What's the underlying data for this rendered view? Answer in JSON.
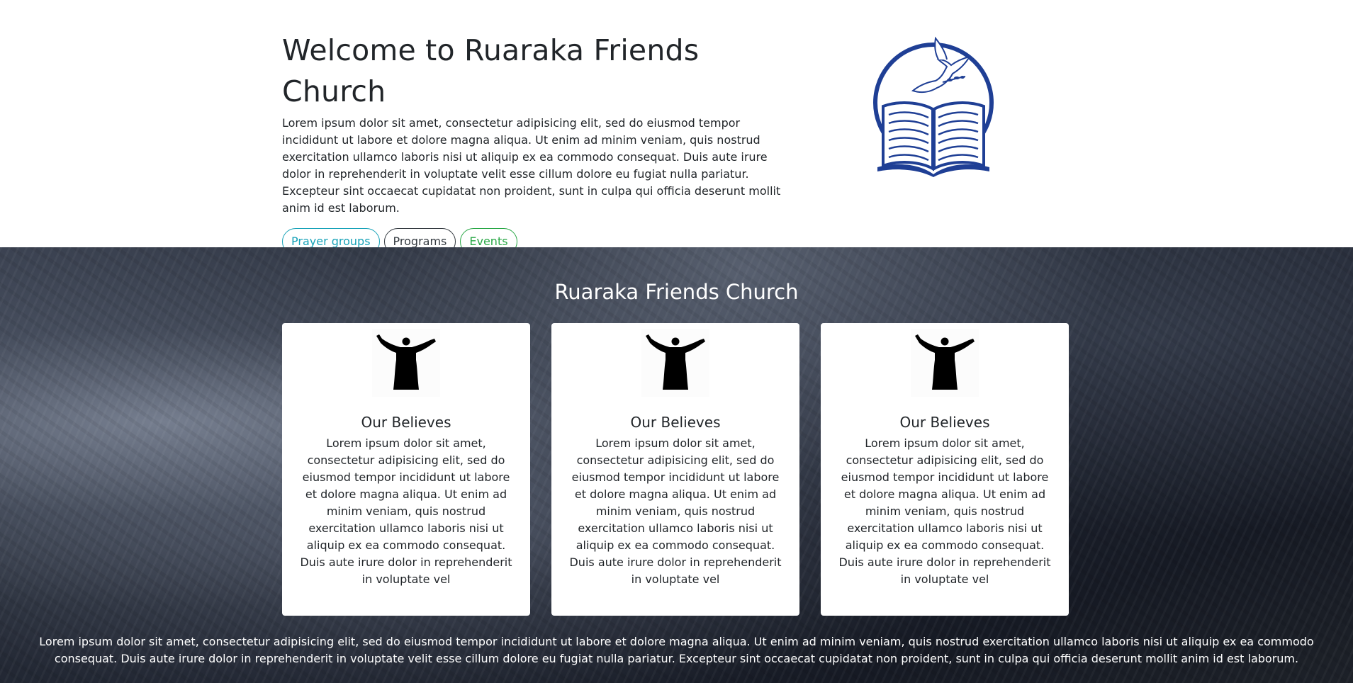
{
  "hero": {
    "title": "Welcome to Ruaraka Friends Church",
    "body": "Lorem ipsum dolor sit amet, consectetur adipisicing elit, sed do eiusmod tempor incididunt ut labore et dolore magna aliqua. Ut enim ad minim veniam, quis nostrud exercitation ullamco laboris nisi ut aliquip ex ea commodo consequat. Duis aute irure dolor in reprehenderit in voluptate velit esse cillum dolore eu fugiat nulla pariatur. Excepteur sint occaecat cupidatat non proident, sunt in culpa qui officia deserunt mollit anim id est laborum.",
    "buttons": {
      "prayer_groups": "Prayer groups",
      "programs": "Programs",
      "events": "Events"
    },
    "logo_icon": "dove-bible-logo-icon"
  },
  "section": {
    "title": "Ruaraka Friends Church",
    "cards": [
      {
        "icon": "praying-figure-icon",
        "title": "Our Believes",
        "text": "Lorem ipsum dolor sit amet, consectetur adipisicing elit, sed do eiusmod tempor incididunt ut labore et dolore magna aliqua. Ut enim ad minim veniam, quis nostrud exercitation ullamco laboris nisi ut aliquip ex ea commodo consequat. Duis aute irure dolor in reprehenderit in voluptate vel"
      },
      {
        "icon": "praying-figure-icon",
        "title": "Our Believes",
        "text": "Lorem ipsum dolor sit amet, consectetur adipisicing elit, sed do eiusmod tempor incididunt ut labore et dolore magna aliqua. Ut enim ad minim veniam, quis nostrud exercitation ullamco laboris nisi ut aliquip ex ea commodo consequat. Duis aute irure dolor in reprehenderit in voluptate vel"
      },
      {
        "icon": "praying-figure-icon",
        "title": "Our Believes",
        "text": "Lorem ipsum dolor sit amet, consectetur adipisicing elit, sed do eiusmod tempor incididunt ut labore et dolore magna aliqua. Ut enim ad minim veniam, quis nostrud exercitation ullamco laboris nisi ut aliquip ex ea commodo consequat. Duis aute irure dolor in reprehenderit in voluptate vel"
      }
    ],
    "footer_text": "Lorem ipsum dolor sit amet, consectetur adipisicing elit, sed do eiusmod tempor incididunt ut labore et dolore magna aliqua. Ut enim ad minim veniam, quis nostrud exercitation ullamco laboris nisi ut aliquip ex ea commodo consequat. Duis aute irure dolor in reprehenderit in voluptate velit esse cillum dolore eu fugiat nulla pariatur. Excepteur sint occaecat cupidatat non proident, sunt in culpa qui officia deserunt mollit anim id est laborum."
  },
  "colors": {
    "logo_blue": "#1f3f95",
    "info": "#17a2b8",
    "dark": "#343a40",
    "success": "#28a745"
  }
}
